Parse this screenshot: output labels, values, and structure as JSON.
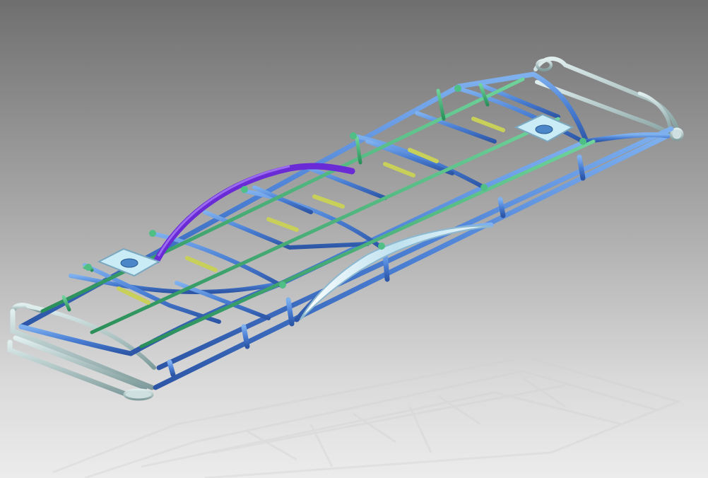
{
  "viewport": {
    "description_icon": "3d-model-viewport"
  },
  "colors": {
    "bg_top": "#6f6f6f",
    "bg_bottom": "#ececec",
    "frame_blue": "#4a7fd4",
    "frame_blue_dark": "#2f58a8",
    "rail_green": "#3aa870",
    "crossbar_yellow": "#c8d05a",
    "arch_purple": "#6a2bd6",
    "plate_lightblue": "#c9ecf6",
    "end_grey": "#a9c3c3",
    "reflection": "#d6d6d6"
  },
  "model": {
    "parts": [
      "outer-frame",
      "inner-longitudinal-rails",
      "cross-members",
      "yellow-crossbars",
      "purple-arch",
      "mounting-plates",
      "end-bumpers",
      "wheel-arch-cutout",
      "floor-reflection"
    ]
  }
}
